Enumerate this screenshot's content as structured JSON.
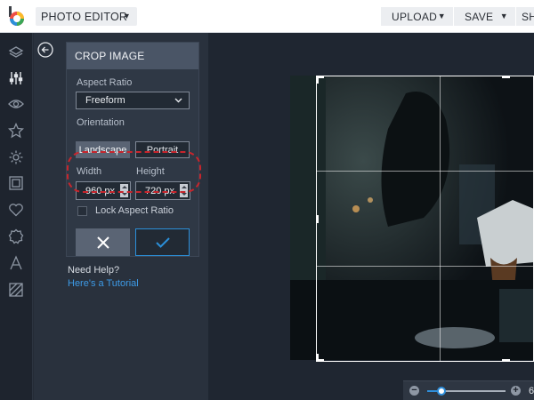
{
  "app": {
    "menu_label": "PHOTO EDITOR",
    "upload_label": "UPLOAD",
    "save_label": "SAVE",
    "share_label": "SH"
  },
  "rail": {
    "icons": [
      "layers-icon",
      "sliders-icon",
      "eye-icon",
      "star-icon",
      "gear-icon",
      "frame-icon",
      "heart-icon",
      "badge-icon",
      "text-icon",
      "texture-icon"
    ]
  },
  "crop": {
    "title": "CROP IMAGE",
    "aspect_label": "Aspect Ratio",
    "aspect_value": "Freeform",
    "orientation_label": "Orientation",
    "landscape_label": "Landscape",
    "portrait_label": "Portrait",
    "selected_orientation": "Landscape",
    "width_label": "Width",
    "height_label": "Height",
    "width_value": "960 px",
    "height_value": "720 px",
    "lock_label": "Lock Aspect Ratio",
    "lock_checked": false
  },
  "help": {
    "title": "Need Help?",
    "link": "Here's a Tutorial"
  },
  "zoom": {
    "value_text": "6",
    "level": 0.18
  },
  "colors": {
    "accent": "#2b8fd9",
    "highlight": "#c8252c",
    "panel": "#29313d",
    "header": "#4a5566"
  }
}
